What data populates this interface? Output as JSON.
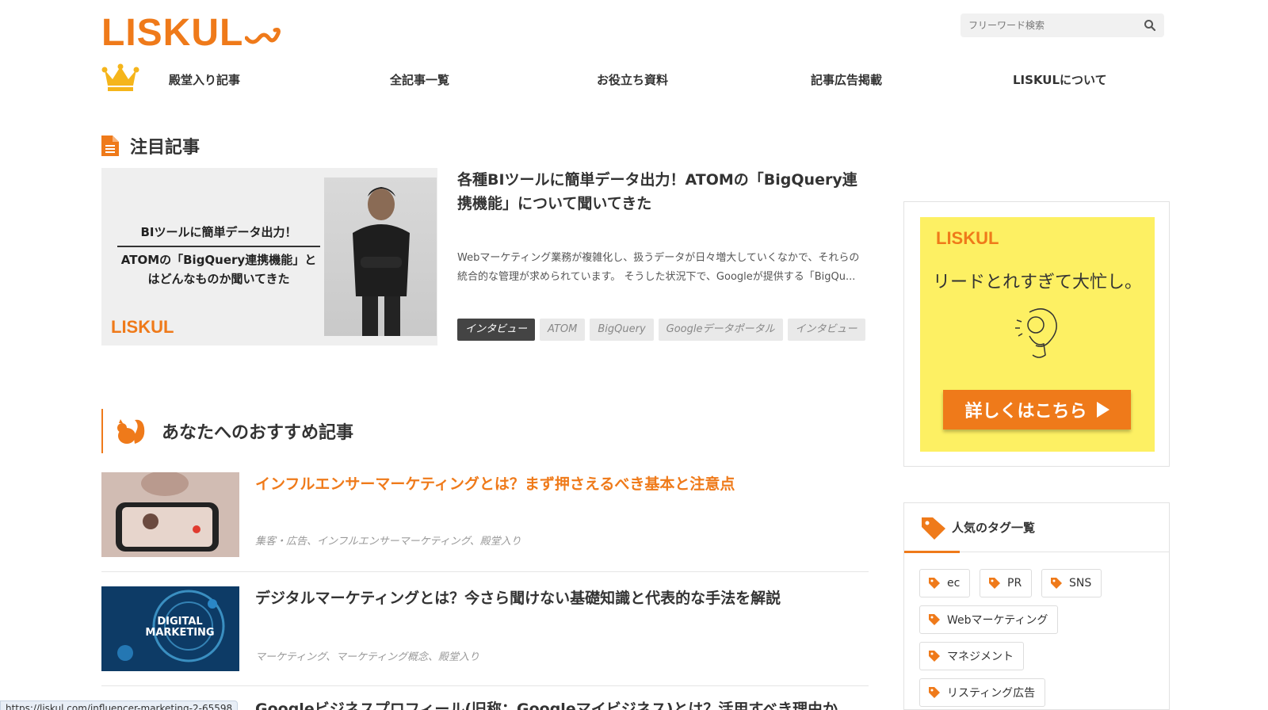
{
  "brand": {
    "logo": "LISKUL",
    "accent": "#ef7a1a"
  },
  "search": {
    "placeholder": "フリーワード検索"
  },
  "nav": [
    {
      "label": "殿堂入り記事"
    },
    {
      "label": "全記事一覧"
    },
    {
      "label": "お役立ち資料"
    },
    {
      "label": "記事広告掲載"
    },
    {
      "label": "LISKULについて"
    }
  ],
  "featured": {
    "section_title": "注目記事",
    "image_caption_1": "BIツールに簡単データ出力！",
    "image_caption_2": "ATOMの「BigQuery連携機能」とはどんなものか聞いてきた",
    "image_logo": "LISKUL",
    "title": "各種BIツールに簡単データ出力！ATOMの「BigQuery連携機能」について聞いてきた",
    "excerpt": "Webマーケティング業務が複雑化し、扱うデータが日々増大していくなかで、それらの統合的な管理が求められています。 そうした状況下で、Googleが提供する「BigQu...",
    "tags": [
      "インタビュー",
      "ATOM",
      "BigQuery",
      "Googleデータポータル",
      "インタビュー"
    ]
  },
  "recommended": {
    "section_title": "あなたへのおすすめ記事",
    "articles": [
      {
        "title": "インフルエンサーマーケティングとは？まず押さえるべき基本と注意点",
        "categories": "集客・広告、インフルエンサーマーケティング、殿堂入り",
        "thumb_label": ""
      },
      {
        "title": "デジタルマーケティングとは？今さら聞けない基礎知識と代表的な手法を解説",
        "categories": "マーケティング、マーケティング概念、殿堂入り",
        "thumb_label": "DIGITAL MARKETING"
      },
      {
        "title": "Googleビジネスプロフィール(旧称：Googleマイビジネス)とは？活用すべき理由か",
        "categories": "",
        "thumb_label": ""
      }
    ]
  },
  "ad": {
    "logo": "LISKUL",
    "text": "リードとれすぎて大忙し。",
    "button": "詳しくはこちら"
  },
  "tag_list": {
    "title": "人気のタグ一覧",
    "tags": [
      "ec",
      "PR",
      "SNS",
      "Webマーケティング",
      "マネジメント",
      "リスティング広告"
    ]
  },
  "status_url": "https://liskul.com/influencer-marketing-2-65598"
}
